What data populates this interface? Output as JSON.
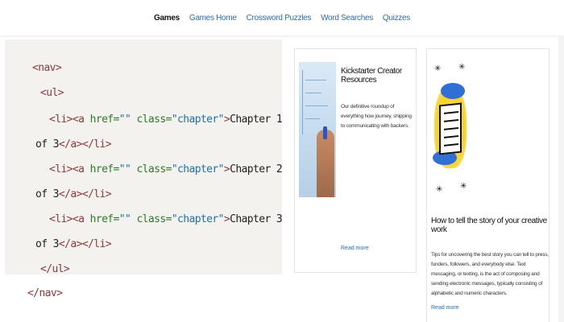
{
  "nav": {
    "items": [
      {
        "label": "Games",
        "active": true
      },
      {
        "label": "Games Home",
        "active": false
      },
      {
        "label": "Crossword Puzzles",
        "active": false
      },
      {
        "label": "Word Searches",
        "active": false
      },
      {
        "label": "Quizzes",
        "active": false
      }
    ]
  },
  "code": {
    "lines": [
      "<nav>",
      "  <ul>",
      "    <li><a href=\"\" class=\"chapter\">Chapter 1",
      "of 3</a></li>",
      "    <li><a href=\"\" class=\"chapter\">Chapter 2",
      "of 3</a></li>",
      "    <li><a href=\"\" class=\"chapter\">Chapter 3",
      "of 3</a></li>",
      "  </ul>",
      "</nav>"
    ],
    "tag_open_nav": "<nav>",
    "tag_open_ul": "<ul>",
    "li_open": "<li>",
    "a_open": "<a ",
    "href_attr": "href=",
    "href_val": "\"\"",
    "class_attr": " class=",
    "class_val": "\"chapter\"",
    "gt": ">",
    "text_ch1": "Chapter 1",
    "text_ch2": "Chapter 2",
    "text_ch3": "Chapter 3",
    "text_of3": "of 3",
    "a_close": "</a>",
    "li_close": "</li>",
    "tag_close_ul": "</ul>",
    "tag_close_nav": "</nav>"
  },
  "cards": [
    {
      "title": "Kickstarter Creator Resources",
      "description": "Our definitive roundup of everything how journey, shipping to communicating with backers.",
      "read_more": "Read more",
      "image": "person-writing-on-whiteboard"
    },
    {
      "title": "How to tell the story of your creative work",
      "description": "Tips for uncovering the best story you can tell to press, funders, followers, and everybody else. Text messaging, or texting, is the act of composing and sending electronic messages, typically consisting of alphabetic and numeric characters.",
      "read_more": "Read more",
      "image": "document-illustration"
    }
  ],
  "colors": {
    "link": "#2b6cb0",
    "tag": "#8b3a3a",
    "attr": "#2b7a2b",
    "string": "#1f6fb0",
    "code_bg": "#f4f2ef"
  }
}
